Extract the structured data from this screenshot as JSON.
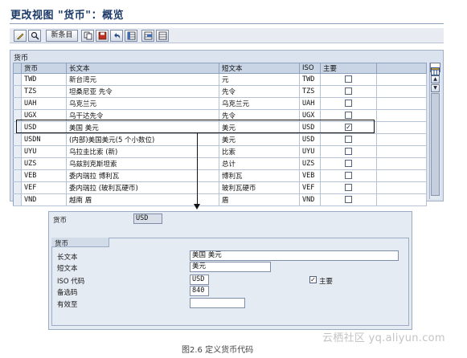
{
  "screen": {
    "title": "更改视图 \"货币\"：概览",
    "new_entries_label": "新条目",
    "toolbar_icons": [
      "edit-icon",
      "display-change-icon",
      "copy-icon",
      "save-icon",
      "undo-icon",
      "select-all-icon",
      "select-block-icon",
      "deselect-all-icon"
    ]
  },
  "table": {
    "caption": "货币",
    "headers": {
      "currency": "货币",
      "long_text": "长文本",
      "short_text": "短文本",
      "iso": "ISO",
      "primary": "主要"
    },
    "rows": [
      {
        "currency": "TWD",
        "long_text": "新台湾元",
        "short_text": "元",
        "iso": "TWD",
        "primary": false
      },
      {
        "currency": "TZS",
        "long_text": "坦桑尼亚 先令",
        "short_text": "先令",
        "iso": "TZS",
        "primary": false
      },
      {
        "currency": "UAH",
        "long_text": "乌克兰元",
        "short_text": "乌克兰元",
        "iso": "UAH",
        "primary": false
      },
      {
        "currency": "UGX",
        "long_text": "乌干达先令",
        "short_text": "先令",
        "iso": "UGX",
        "primary": false
      },
      {
        "currency": "USD",
        "long_text": "美国 美元",
        "short_text": "美元",
        "iso": "USD",
        "primary": true
      },
      {
        "currency": "USDN",
        "long_text": "(内部)美国美元(5 个小数位)",
        "short_text": "美元",
        "iso": "USD",
        "primary": false
      },
      {
        "currency": "UYU",
        "long_text": "乌拉圭比索 (新)",
        "short_text": "比索",
        "iso": "UYU",
        "primary": false
      },
      {
        "currency": "UZS",
        "long_text": "乌兹别克斯坦索",
        "short_text": "总计",
        "iso": "UZS",
        "primary": false
      },
      {
        "currency": "VEB",
        "long_text": "委内瑞拉 博利瓦",
        "short_text": "博利瓦",
        "iso": "VEB",
        "primary": false
      },
      {
        "currency": "VEF",
        "long_text": "委内瑞拉 (玻利瓦硬币)",
        "short_text": "玻利瓦硬币",
        "iso": "VEF",
        "primary": false
      },
      {
        "currency": "VND",
        "long_text": "越南 盾",
        "short_text": "盾",
        "iso": "VND",
        "primary": false
      }
    ]
  },
  "detail": {
    "key_label": "货币",
    "key_value": "USD",
    "group_title": "货币",
    "long_text_label": "长文本",
    "long_text_value": "美国 美元",
    "short_text_label": "短文本",
    "short_text_value": "美元",
    "iso_label": "ISO 代码",
    "iso_value": "USD",
    "primary_label": "主要",
    "primary_checked": true,
    "alt_key_label": "备选码",
    "alt_key_value": "840",
    "valid_until_label": "有效至",
    "valid_until_value": ""
  },
  "watermark": "云栖社区 yq.aliyun.com",
  "figure_caption": "图2.6 定义货币代码"
}
